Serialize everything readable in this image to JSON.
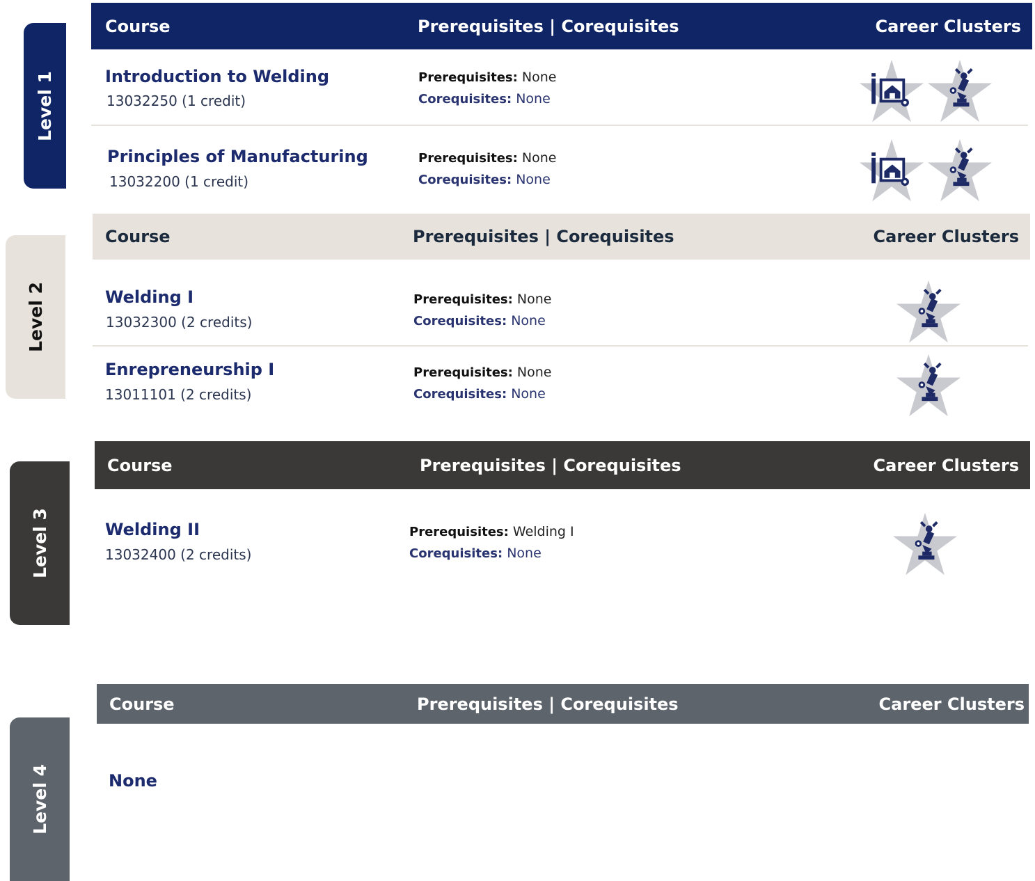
{
  "colors": {
    "navy": "#0f2566",
    "beige": "#e7e3dc",
    "charcoal": "#3a3937",
    "slate": "#5e646b",
    "icon_navy": "#1d2a66",
    "star_gray": "#c9cacf"
  },
  "levels": [
    {
      "label": "Level 1",
      "header": {
        "course": "Course",
        "prereq": "Prerequisites | Corequisites",
        "clusters": "Career Clusters"
      },
      "courses": [
        {
          "title": "Introduction to Welding",
          "code": "13032250  (1 credit)",
          "prereq_label": "Prerequisites:",
          "prereq": "None",
          "coreq_label": "Corequisites:",
          "coreq": "None",
          "icons": [
            "architecture-construction-icon",
            "manufacturing-icon"
          ]
        },
        {
          "title": "Principles of Manufacturing",
          "code": "13032200  (1 credit)",
          "prereq_label": "Prerequisites:",
          "prereq": "None",
          "coreq_label": "Corequisites:",
          "coreq": "None",
          "icons": [
            "architecture-construction-icon",
            "manufacturing-icon"
          ]
        }
      ]
    },
    {
      "label": "Level 2",
      "header": {
        "course": "Course",
        "prereq": "Prerequisites | Corequisites",
        "clusters": "Career Clusters"
      },
      "courses": [
        {
          "title": "Welding I",
          "code": "13032300  (2 credits)",
          "prereq_label": "Prerequisites:",
          "prereq": "None",
          "coreq_label": "Corequisites:",
          "coreq": "None",
          "icons": [
            "manufacturing-icon"
          ]
        },
        {
          "title": "Enrepreneurship I",
          "code": "13011101  (2 credits)",
          "prereq_label": "Prerequisites:",
          "prereq": "None",
          "coreq_label": "Corequisites:",
          "coreq": "None",
          "icons": [
            "manufacturing-icon"
          ]
        }
      ]
    },
    {
      "label": "Level 3",
      "header": {
        "course": "Course",
        "prereq": "Prerequisites | Corequisites",
        "clusters": "Career Clusters"
      },
      "courses": [
        {
          "title": "Welding II",
          "code": "13032400  (2 credits)",
          "prereq_label": "Prerequisites:",
          "prereq": "Welding I",
          "coreq_label": "Corequisites:",
          "coreq": "None",
          "icons": [
            "manufacturing-icon"
          ]
        }
      ]
    },
    {
      "label": "Level 4",
      "header": {
        "course": "Course",
        "prereq": "Prerequisites | Corequisites",
        "clusters": "Career Clusters"
      },
      "none_text": "None"
    }
  ]
}
